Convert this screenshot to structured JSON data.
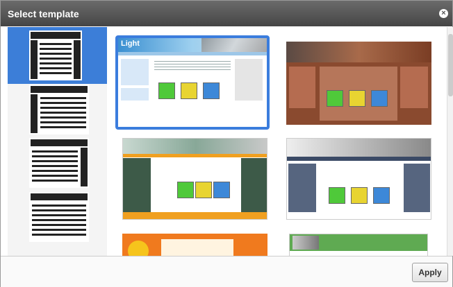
{
  "dialog": {
    "title": "Select template",
    "close_icon": "close-icon",
    "apply_label": "Apply"
  },
  "layouts": [
    {
      "name": "layout-two-sidebars"
    },
    {
      "name": "layout-left-sidebar"
    },
    {
      "name": "layout-right-sidebar"
    },
    {
      "name": "layout-full-width"
    }
  ],
  "templates": [
    {
      "name": "template-light",
      "label": "Light"
    },
    {
      "name": "template-brown",
      "label": ""
    },
    {
      "name": "template-green-orange",
      "label": ""
    },
    {
      "name": "template-grey",
      "label": ""
    },
    {
      "name": "template-orange-sun",
      "label": ""
    },
    {
      "name": "template-green-bar",
      "label": ""
    }
  ],
  "colors": {
    "accent": "#3b7ddd",
    "titlebar": "#4a4a4a"
  }
}
